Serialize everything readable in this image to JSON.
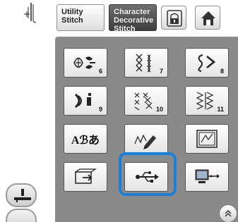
{
  "tabs": {
    "utility_label_line1": "Utility",
    "utility_label_line2": "Stitch",
    "character_label_line1": "Character",
    "character_label_line2": "Decorative",
    "character_label_line3": "Stitch"
  },
  "grid": {
    "r1": [
      "6",
      "7",
      "8"
    ],
    "r2": [
      "9",
      "10",
      "11"
    ],
    "r3_text": "Aℬあ"
  },
  "icons": {
    "needle": "needle-position-icon",
    "lock": "lock-icon",
    "home": "home-icon",
    "presser": "presser-foot-icon",
    "usb": "usb-icon",
    "pocket": "pocket-memory-icon",
    "computer": "computer-usb-icon",
    "scroll": "scroll-up-icon"
  },
  "colors": {
    "highlight": "#1e7fd6",
    "panel": "#8a8a8a",
    "active_tab": "#4a4a4a"
  }
}
